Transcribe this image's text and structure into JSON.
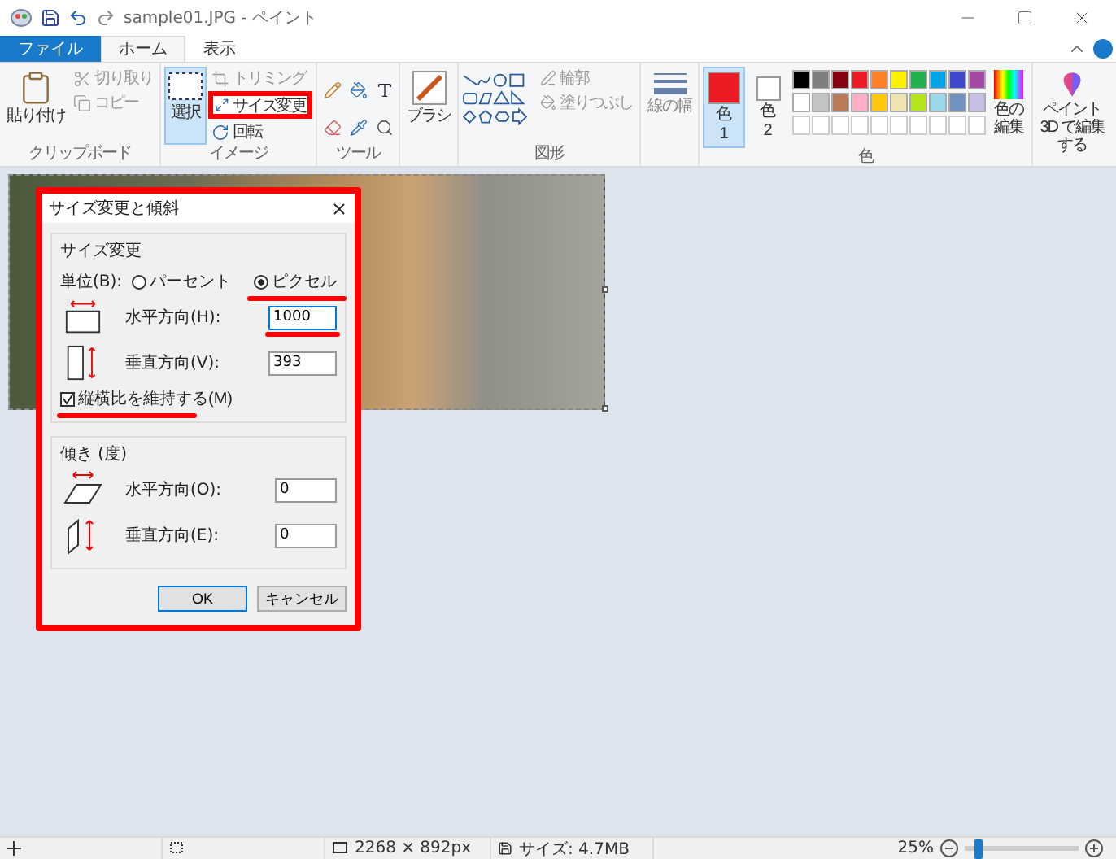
{
  "window": {
    "title": "sample01.JPG - ペイント"
  },
  "tabs": [
    {
      "label": "ファイル",
      "kind": "file",
      "selected": false
    },
    {
      "label": "ホーム",
      "kind": "tab",
      "selected": true
    },
    {
      "label": "表示",
      "kind": "tab",
      "selected": false
    }
  ],
  "ribbon": {
    "clipboard": {
      "label": "クリップボード",
      "paste": "貼り付け",
      "cut": "切り取り",
      "copy": "コピー"
    },
    "image": {
      "label": "イメージ",
      "select": "選択",
      "crop": "トリミング",
      "resize": "サイズ変更",
      "rotate": "回転"
    },
    "tools": {
      "label": "ツール"
    },
    "brush": "ブラシ",
    "shapes": {
      "label": "図形",
      "outline": "輪郭",
      "fill": "塗りつぶし"
    },
    "size": "線の幅",
    "colors": {
      "label": "色",
      "color1": {
        "label": "色",
        "number": "1",
        "color": "#ed1c24",
        "selected": true
      },
      "color2": {
        "label": "色",
        "number": "2",
        "color": "#ffffff",
        "selected": false
      },
      "palette": [
        {
          "color": "#000000"
        },
        {
          "color": "#7f7f7f"
        },
        {
          "color": "#880015"
        },
        {
          "color": "#ed1c24"
        },
        {
          "color": "#ff7f27"
        },
        {
          "color": "#fff200"
        },
        {
          "color": "#22b14c"
        },
        {
          "color": "#00a2e8"
        },
        {
          "color": "#3f48cc"
        },
        {
          "color": "#a349a4"
        },
        {
          "color": "#ffffff"
        },
        {
          "color": "#c3c3c3"
        },
        {
          "color": "#b97a57"
        },
        {
          "color": "#ffaec9"
        },
        {
          "color": "#ffc90e"
        },
        {
          "color": "#efe4b0"
        },
        {
          "color": "#b5e61d"
        },
        {
          "color": "#99d9ea"
        },
        {
          "color": "#7092be"
        },
        {
          "color": "#c8bfe7"
        }
      ],
      "edit": "色の編集"
    },
    "paint3d": "ペイント 3D で編集する"
  },
  "dialog": {
    "title": "サイズ変更と傾斜",
    "resize_section": "サイズ変更",
    "unit_label": "単位(B):",
    "units": [
      {
        "label": "パーセント",
        "selected": false
      },
      {
        "label": "ピクセル",
        "selected": true
      }
    ],
    "horizontal": {
      "label": "水平方向(H):",
      "value": "1000"
    },
    "vertical": {
      "label": "垂直方向(V):",
      "value": "393"
    },
    "keep_ratio": {
      "label": "縦横比を維持する(M)",
      "checked": true
    },
    "skew_section": "傾き (度)",
    "skew_horizontal": {
      "label": "水平方向(O):",
      "value": "0"
    },
    "skew_vertical": {
      "label": "垂直方向(E):",
      "value": "0"
    },
    "buttons": [
      "OK",
      "キャンセル"
    ]
  },
  "status_bar": {
    "dimensions": "2268 × 892px",
    "file_size": "サイズ: 4.7MB",
    "zoom": "25%",
    "zoom_level": {
      "level": 0.12
    }
  }
}
